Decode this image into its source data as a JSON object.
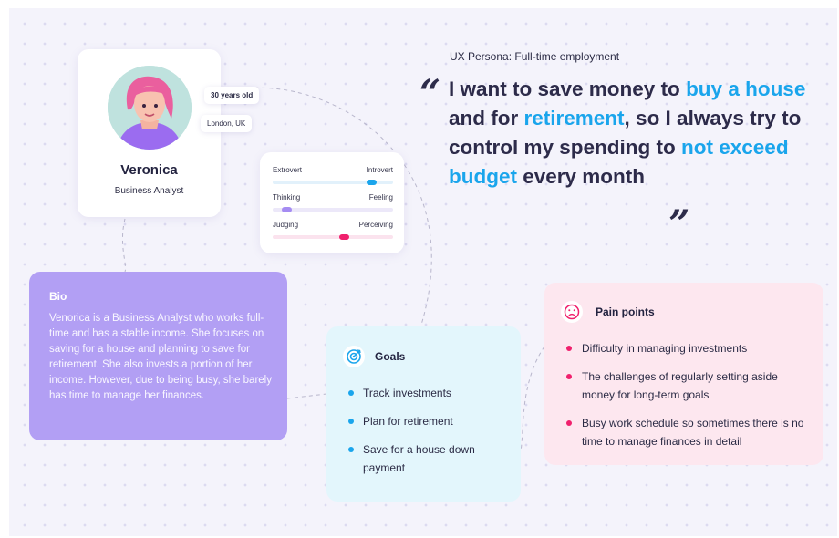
{
  "profile": {
    "name": "Veronica",
    "role": "Business Analyst",
    "age": "30 years old",
    "location": "London, UK"
  },
  "traits": [
    {
      "left": "Extrovert",
      "right": "Introvert",
      "level": 0.85
    },
    {
      "left": "Thinking",
      "right": "Feeling",
      "level": 0.08
    },
    {
      "left": "Judging",
      "right": "Perceiving",
      "level": 0.6
    }
  ],
  "persona_label": "UX Persona: Full-time employment",
  "quote": {
    "p1": "I want to save money to ",
    "h1": "buy a house",
    "p2": " and for ",
    "h2": "retirement",
    "p3": ", so I always try to control my spending to ",
    "h3": "not exceed budget",
    "p4": " every month"
  },
  "bio": {
    "title": "Bio",
    "text": "Venorica is a Business Analyst who works full-time and has a stable income. She focuses on saving for a house and planning to save for retirement. She also invests a portion of her income. However, due to being busy, she barely has time to manage her finances."
  },
  "goals": {
    "title": "Goals",
    "icon": "target-icon",
    "items": [
      "Track investments",
      "Plan for retirement",
      "Save for a house down payment"
    ]
  },
  "pain_points": {
    "title": "Pain points",
    "icon": "sad-face-icon",
    "items": [
      "Difficulty in managing investments",
      "The challenges of regularly setting aside money for long-term goals",
      "Busy work schedule so sometimes there is no time to manage finances in detail"
    ]
  },
  "colors": {
    "accent_blue": "#1aa5ec",
    "accent_purple": "#b29ff4",
    "accent_pink": "#f0206d",
    "goals_bg": "#e3f6fc",
    "pain_bg": "#fde7ef"
  }
}
